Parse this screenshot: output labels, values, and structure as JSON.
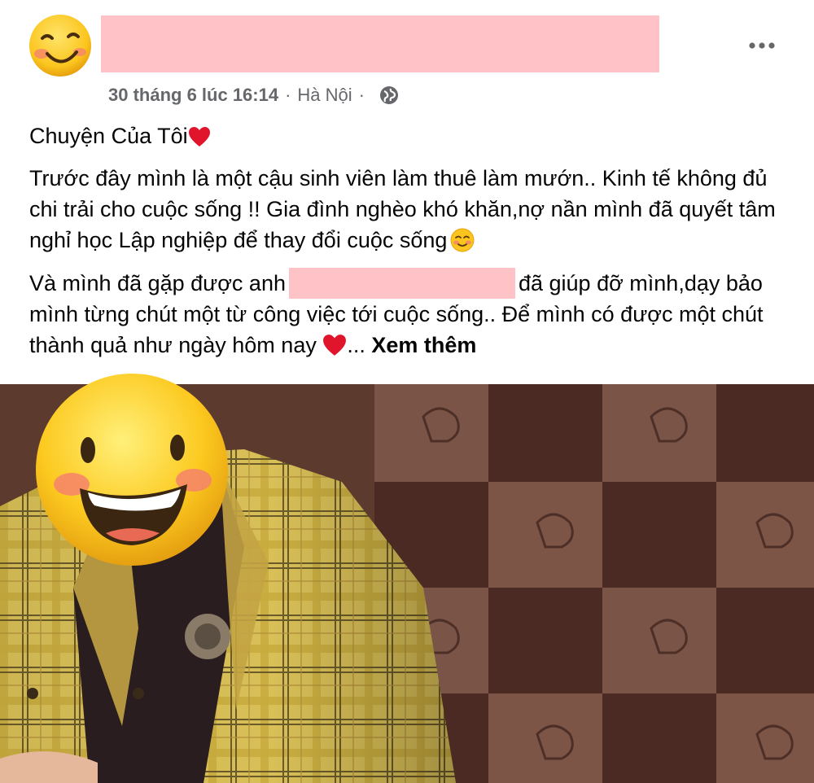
{
  "post": {
    "timestamp": "30 tháng 6 lúc 16:14",
    "separator": "·",
    "location": "Hà Nội",
    "icons": {
      "avatar": "smiling-face-avatar",
      "more": "more-horizontal-icon",
      "privacy": "globe-icon",
      "heart": "red-heart-icon",
      "blush": "smiling-face-icon",
      "face_sticker": "grinning-face-sticker"
    },
    "text": {
      "title": "Chuyện Của Tôi",
      "paragraph1": "Trước đây mình là một cậu sinh viên làm thuê làm mướn.. Kinh tế không đủ chi trải cho cuộc sống !! Gia đình nghèo khó khăn,nợ nần mình đã quyết tâm nghỉ học Lập nghiệp để thay đổi cuộc sống",
      "paragraph2_start": "Và mình đã gặp được anh",
      "paragraph2_rest": "đã giúp đỡ mình,dạy bảo mình từng chút một từ công việc tới cuộc sống.. Để mình có được một chút thành quả như ngày hôm nay",
      "ellipsis": "...",
      "see_more": "Xem thêm"
    },
    "colors": {
      "redaction": "#ffc2c6",
      "meta_text": "#65676b",
      "body_text": "#050505",
      "heart": "#e0152b",
      "emoji_yellow": "#fbc51e"
    }
  }
}
